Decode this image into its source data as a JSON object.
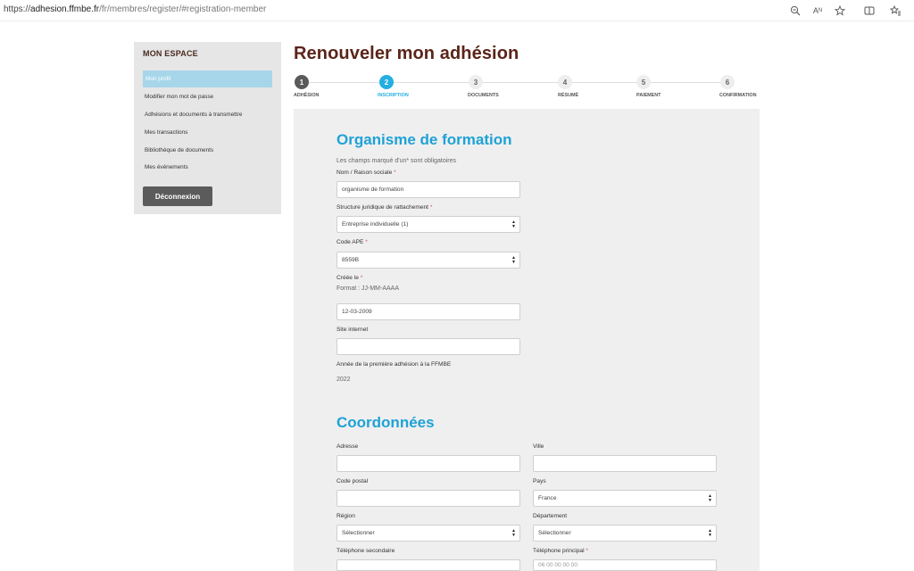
{
  "browser": {
    "url_prefix": "https://",
    "url_domain": "adhesion.ffmbe.fr",
    "url_path": "/fr/membres/register/#registration-member",
    "icons": [
      "zoom-icon",
      "read-aloud-icon",
      "favorite-star-icon",
      "split-screen-icon",
      "favorites-list-icon"
    ]
  },
  "sidebar": {
    "title": "MON ESPACE",
    "items": [
      {
        "label": "Mon profil",
        "active": true
      },
      {
        "label": "Modifier mon mot de passe",
        "active": false
      },
      {
        "label": "Adhésions et documents à transmettre",
        "active": false
      },
      {
        "label": "Mes transactions",
        "active": false
      },
      {
        "label": "Bibliothèque de documents",
        "active": false
      },
      {
        "label": "Mes événements",
        "active": false
      }
    ],
    "logout_label": "Déconnexion"
  },
  "page": {
    "title": "Renouveler mon adhésion"
  },
  "steps": [
    {
      "num": "1",
      "label": "ADHÉSION",
      "state": "done"
    },
    {
      "num": "2",
      "label": "INSCRIPTION",
      "state": "current"
    },
    {
      "num": "3",
      "label": "DOCUMENTS",
      "state": "todo"
    },
    {
      "num": "4",
      "label": "RÉSUMÉ",
      "state": "todo"
    },
    {
      "num": "5",
      "label": "PAIEMENT",
      "state": "todo"
    },
    {
      "num": "6",
      "label": "CONFIRMATION",
      "state": "todo"
    }
  ],
  "organisme": {
    "title": "Organisme de formation",
    "required_note": "Les champs marqué d'un* sont obligatoires",
    "raison_sociale": {
      "label": "Nom / Raison sociale",
      "value": "organisme de formation"
    },
    "structure": {
      "label": "Structure juridique de rattachement",
      "value": "Entreprise individuelle (1)"
    },
    "code_ape": {
      "label": "Code APE",
      "value": "8559B"
    },
    "creee_le": {
      "label": "Créée le",
      "format": "Format : JJ-MM-AAAA",
      "value": "12-03-2009"
    },
    "site": {
      "label": "Site internet",
      "value": ""
    },
    "premiere_adhesion": {
      "label": "Année de la première adhésion à la FFMBE",
      "value": "2022"
    }
  },
  "coordonnees": {
    "title": "Coordonnées",
    "adresse": {
      "label": "Adresse",
      "value": ""
    },
    "ville": {
      "label": "Ville",
      "value": ""
    },
    "code_postal": {
      "label": "Code postal",
      "value": ""
    },
    "pays": {
      "label": "Pays",
      "value": "France"
    },
    "region": {
      "label": "Région",
      "value": "Sélectionner"
    },
    "departement": {
      "label": "Département",
      "value": "Sélectionner"
    },
    "tel_secondaire": {
      "label": "Téléphone secondaire",
      "value": ""
    },
    "tel_principal": {
      "label": "Téléphone principal",
      "value": "06 00 00 00 00"
    }
  },
  "colors": {
    "title_brown": "#5b2419",
    "accent_blue": "#1ea2d6",
    "sidebar_active": "#a7d6ea",
    "button_dark": "#5b5b5b"
  }
}
